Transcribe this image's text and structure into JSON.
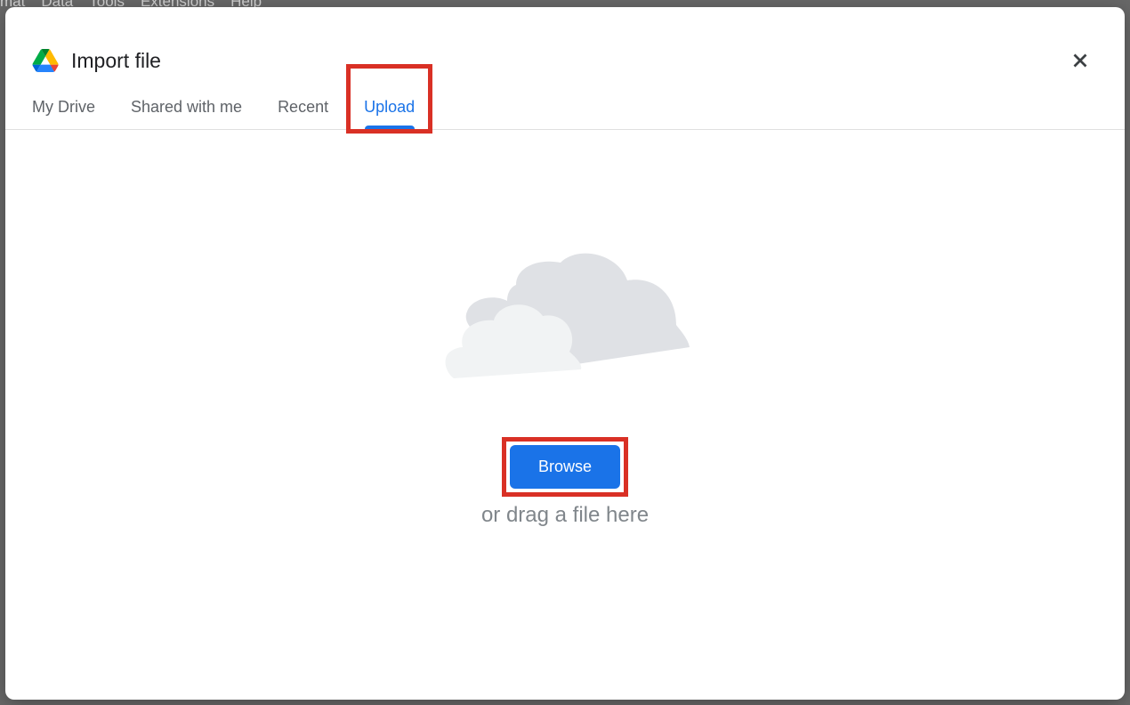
{
  "background_menu": {
    "items": [
      "mat",
      "Data",
      "Tools",
      "Extensions",
      "Help"
    ]
  },
  "modal": {
    "title": "Import file"
  },
  "tabs": {
    "items": [
      {
        "label": "My Drive",
        "active": false
      },
      {
        "label": "Shared with me",
        "active": false
      },
      {
        "label": "Recent",
        "active": false
      },
      {
        "label": "Upload",
        "active": true
      }
    ]
  },
  "upload": {
    "browse_label": "Browse",
    "drag_text": "or drag a file here"
  },
  "colors": {
    "accent": "#1a73e8",
    "highlight": "#d93025",
    "text_secondary": "#80868b"
  }
}
